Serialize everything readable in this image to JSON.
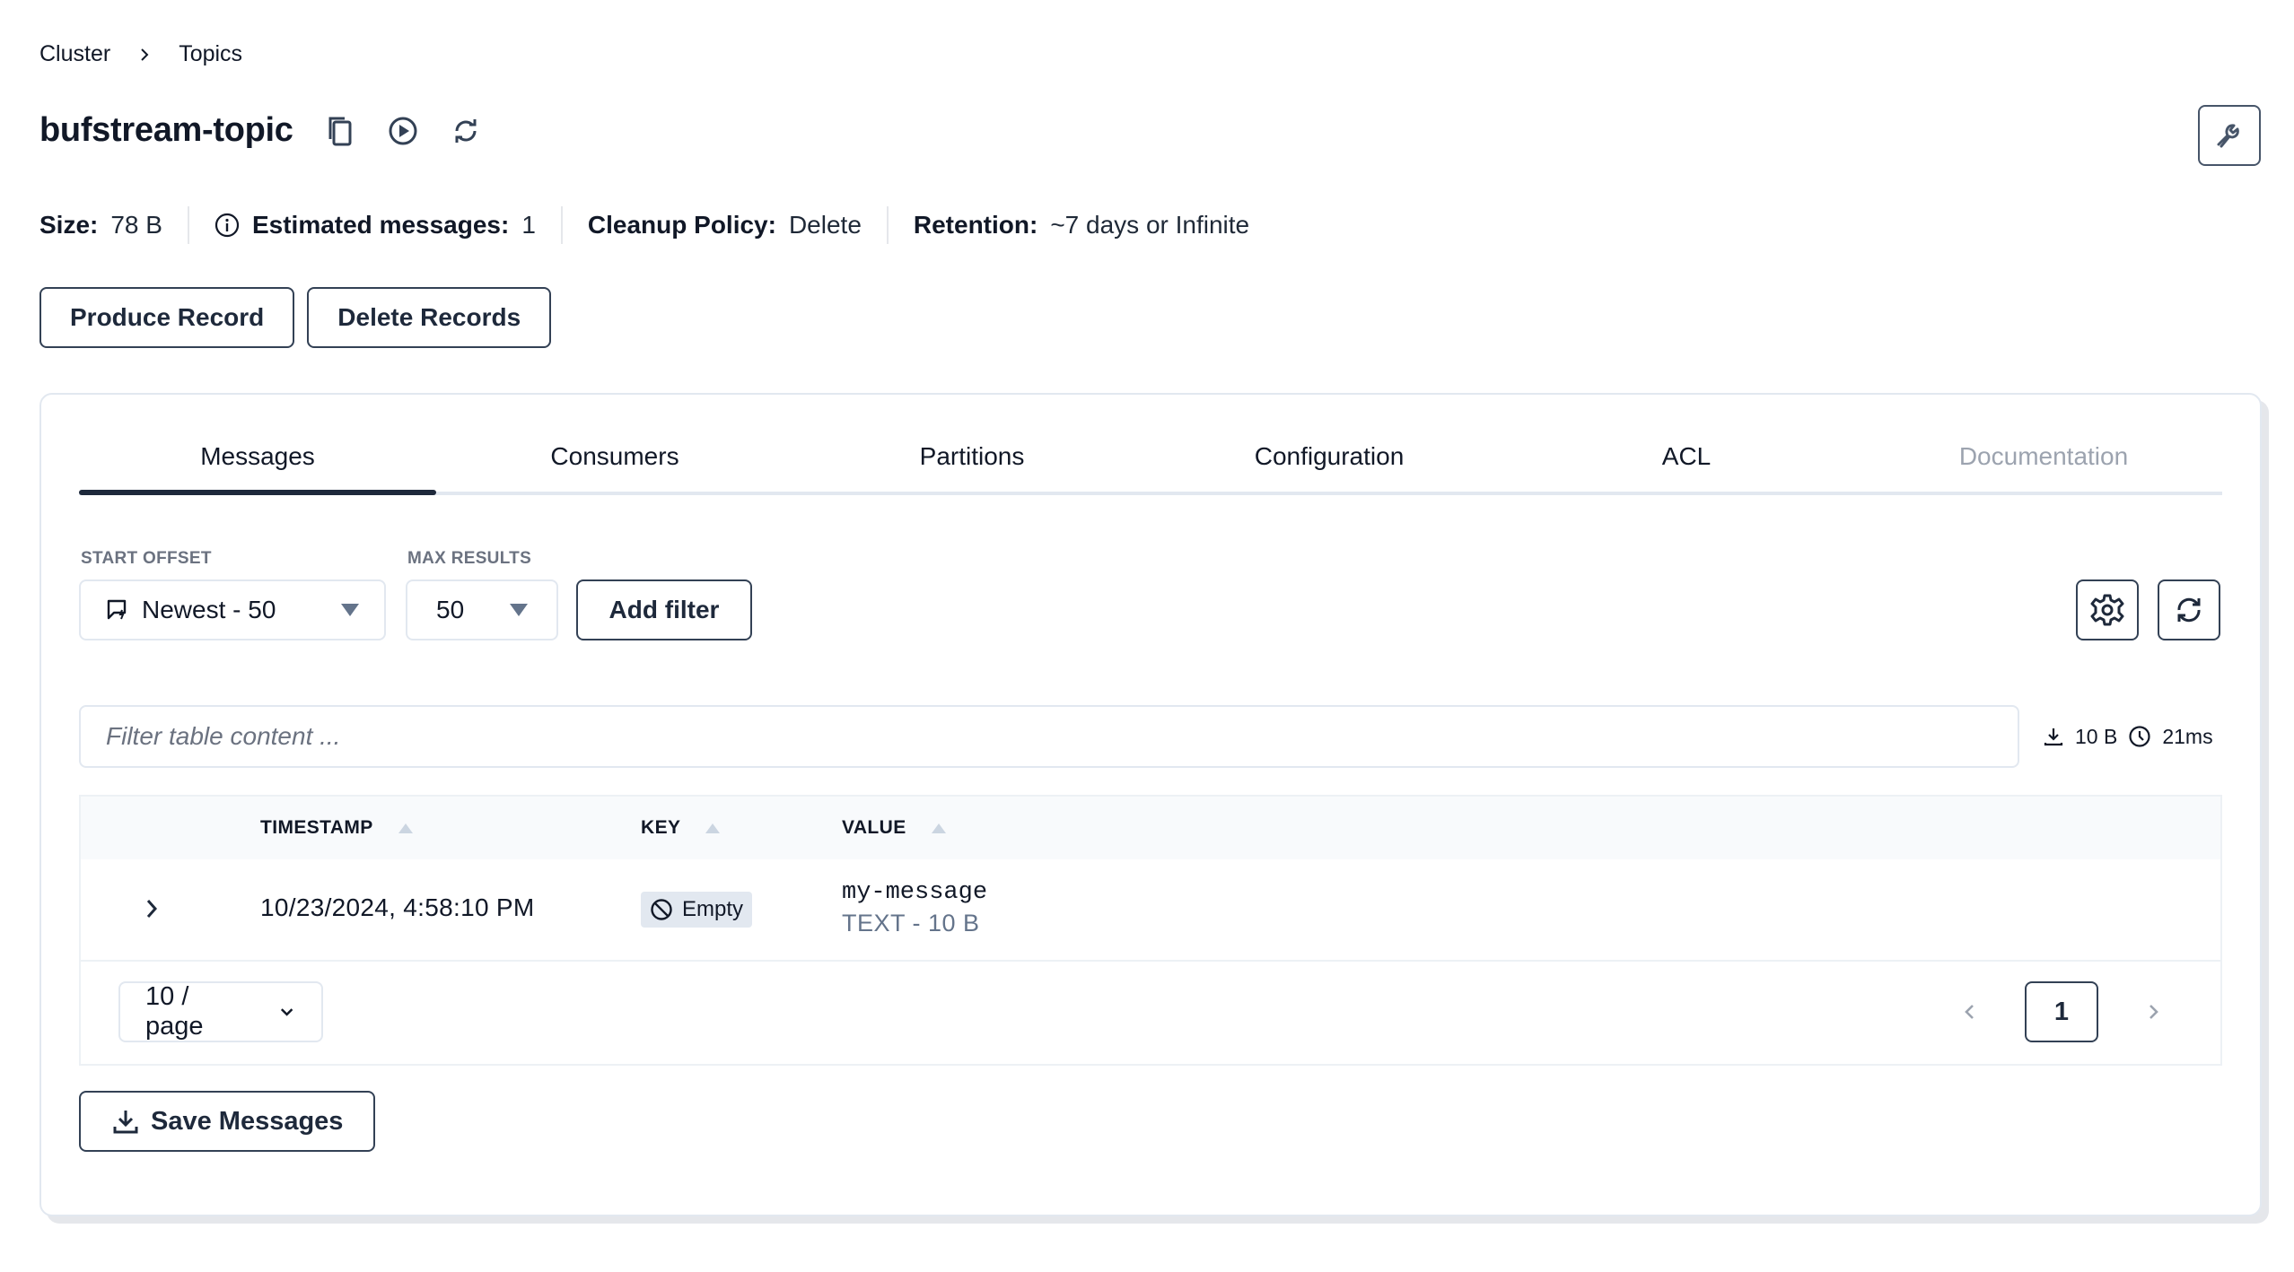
{
  "breadcrumb": {
    "items": [
      "Cluster",
      "Topics"
    ]
  },
  "topic": {
    "title": "bufstream-topic",
    "icons": [
      "copy-icon",
      "play-circle-icon",
      "refresh-icon"
    ],
    "settings_icon": "wrench-icon"
  },
  "stats": {
    "size_label": "Size:",
    "size_value": "78 B",
    "messages_label": "Estimated messages:",
    "messages_value": "1",
    "cleanup_label": "Cleanup Policy:",
    "cleanup_value": "Delete",
    "retention_label": "Retention:",
    "retention_value": "~7 days or Infinite"
  },
  "actions": {
    "produce": "Produce Record",
    "delete": "Delete Records"
  },
  "tabs": [
    {
      "label": "Messages",
      "active": true
    },
    {
      "label": "Consumers"
    },
    {
      "label": "Partitions"
    },
    {
      "label": "Configuration"
    },
    {
      "label": "ACL"
    },
    {
      "label": "Documentation",
      "disabled": true
    }
  ],
  "controls": {
    "start_offset_label": "START OFFSET",
    "start_offset_value": "Newest - 50",
    "max_results_label": "MAX RESULTS",
    "max_results_value": "50",
    "add_filter": "Add filter"
  },
  "filter": {
    "placeholder": "Filter table content ..."
  },
  "meta": {
    "bytes": "10 B",
    "duration": "21ms"
  },
  "table": {
    "columns": [
      "TIMESTAMP",
      "KEY",
      "VALUE"
    ],
    "rows": [
      {
        "timestamp": "10/23/2024, 4:58:10 PM",
        "key": "Empty",
        "value": "my-message",
        "value_meta": "TEXT - 10 B"
      }
    ]
  },
  "pagination": {
    "page_size": "10 / page",
    "current_page": "1"
  },
  "save_messages": "Save Messages"
}
